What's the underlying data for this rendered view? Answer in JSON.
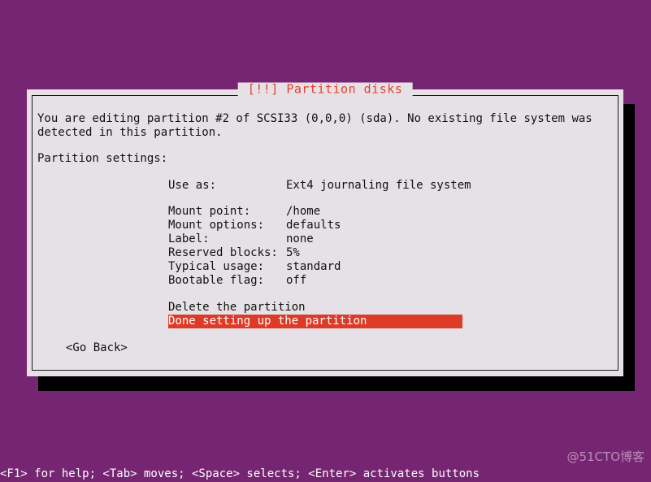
{
  "screen": {
    "background_color": "#762572"
  },
  "dialog": {
    "title": "[!!] Partition disks",
    "title_color": "#e0432c",
    "background_color": "#e6e1e6",
    "intro": {
      "line1": "You are editing partition #2 of SCSI33 (0,0,0) (sda). No existing file system was",
      "line2": "detected in this partition."
    },
    "settings_heading": "Partition settings:",
    "settings": [
      {
        "label": "Use as:",
        "value": "Ext4 journaling file system"
      },
      {
        "label": "Mount point:",
        "value": "/home"
      },
      {
        "label": "Mount options:",
        "value": "defaults"
      },
      {
        "label": "Label:",
        "value": "none"
      },
      {
        "label": "Reserved blocks:",
        "value": "5%"
      },
      {
        "label": "Typical usage:",
        "value": "standard"
      },
      {
        "label": "Bootable flag:",
        "value": "off"
      }
    ],
    "actions": [
      {
        "label": "Delete the partition",
        "selected": false
      },
      {
        "label": "Done setting up the partition",
        "selected": true
      }
    ],
    "selected_color": "#dd3b27",
    "go_back": "<Go Back>"
  },
  "help_bar": {
    "text": "<F1> for help; <Tab> moves; <Space> selects; <Enter> activates buttons"
  },
  "watermark": {
    "text": "@51CTO博客"
  }
}
